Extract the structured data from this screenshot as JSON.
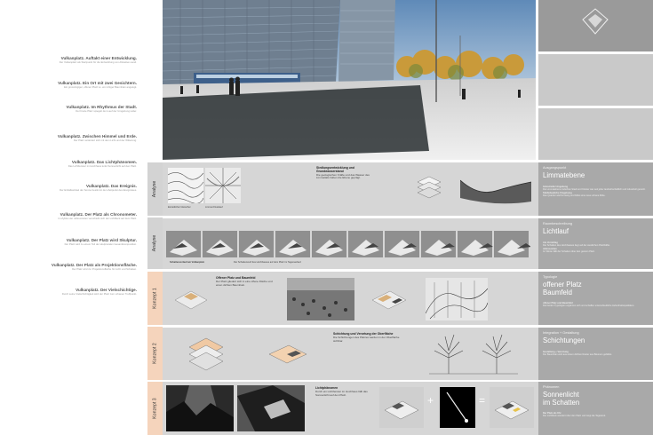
{
  "left_entries": [
    {
      "title": "Vulkanplatz. Auftakt einer Entwicklung.",
      "sub": "Der Vulkanplatz als Startpunkt für die Entwicklung von Altstetten-Land."
    },
    {
      "title": "Vulkanplatz. Ein Ort mit zwei Gesichtern.",
      "sub": "Ein grosszügiger, offener Platz vs. ein ruhiger Baumhain angelegt."
    },
    {
      "title": "Vulkanplatz. Im Rhythmus der Stadt.",
      "sub": "Der breite Platz spiegelt den Lauf der Umgebung wider."
    },
    {
      "title": "Vulkanplatz. Zwischen Himmel und Erde.",
      "sub": "Der Platz verändert sich mit dem Licht und der Witterung."
    },
    {
      "title": "Vulkanplatz. Das Lichtphänomen.",
      "sub": "Das Lichtfenster im Hochhaus lenkt Sonnenlicht auf den Platz."
    },
    {
      "title": "Vulkanplatz. Das Ereignis.",
      "sub": "Der Einfallswinkel der Sonne bestimmt den Zeitpunkt des Ereignisses."
    },
    {
      "title": "Vulkanplatz. Der Platz als Chronometer.",
      "sub": "Im Zyklus der Jahreszeiten verschiebt sich der Lichtfleck auf dem Platz."
    },
    {
      "title": "Vulkanplatz. Der Platz wird Skulptur.",
      "sub": "Der Platz wird zu einem Teil der skulpturalen Gesamtkomposition."
    },
    {
      "title": "Vulkanplatz. Der Platz als Projektionsfläche.",
      "sub": "Der Platz wird zur Projektionsfläche für Licht und Schatten."
    },
    {
      "title": "Vulkanplatz. Der Vielschichtige.",
      "sub": "Durch seine Vielschichtigkeit wird der Platz zum urbanen Treffpunkt."
    }
  ],
  "tabs": {
    "analyse_1": "Analyse",
    "analyse_2": "Analyse",
    "konzept_1": "Konzept 1",
    "konzept_2": "Konzept 2",
    "konzept_3": "Konzept 3"
  },
  "bands": {
    "b1": {
      "kicker": "Ausgangspunkt",
      "title": "Limmatebene",
      "heading": "Siedlungsentwicklung und Grundwasserstand",
      "text": "Die geologischen Kräfte und das Wasser des Limmattals haben die Ebene geprägt.",
      "caption_a": "Eiszeitlicher Gletscher",
      "caption_b": "Limmat Flusslauf",
      "p1_head": "Industrielle Umgebung",
      "p1": "Die Limmatebene zwischen Stadt und Kloster war seit jeher landwirtschaftlich und industriell genutzt.",
      "p2_head": "Städtebauliche Umgebung",
      "p2": "Das Quartier wächst stetig und bildet eine neue urbane Mitte."
    },
    "b2": {
      "kicker": "Raumbeschreibung",
      "title": "Lichtlauf",
      "caption": "Schattenverlauf am Vulkanplatz",
      "note": "Der Schattenwurf des Hochhauses auf dem Platz im Tagesverlauf.",
      "p1_head": "Am Vormittag",
      "p1": "Der Schatten des Hochhauses liegt auf der westlichen Platzhälfte.",
      "p2_head": "Jahreszeiten",
      "p2": "Im Winter fällt der Schatten über den ganzen Platz."
    },
    "b3": {
      "kicker": "Typologie",
      "title": "offener Platz\nBaumfeld",
      "heading": "Offener Platz und Baumfeld",
      "text": "Der Platz gliedert sich in eine offene Fläche und einen dichten Baumhain.",
      "p1_head": "offener Platz und Baumfeld",
      "p1": "Die beiden Typologien ergänzen sich und schaffen unterschiedliche Aufenthaltsqualitäten."
    },
    "b4": {
      "kicker": "Integration + Gestaltung",
      "title": "Schichtungen",
      "heading": "Schichtung und Verortung der Oberfläche",
      "text": "Die Schichtungen des Platzes werden in der Oberfläche sichtbar.",
      "p1_head": "Gestaltung + Verortung",
      "p1": "Der Baumhain wird aus einem dichten Raster aus Bäumen gebildet."
    },
    "b5": {
      "kicker": "Phänomen",
      "title": "Sonnenlicht\nim Schatten",
      "heading": "Lichtphänomen",
      "text": "Durch ein Lichtfenster im Hochhaus fällt das Sonnenlicht auf den Platz.",
      "p1_head": "Der Platz als Uhr",
      "p1": "Der Lichtfleck wandert über den Platz und zeigt die Tageszeit."
    },
    "plus": "+",
    "equals": "="
  },
  "colors": {
    "band_bg": "#d6d6d6",
    "panel_bg": "#a9a9a9",
    "tab_peach": "#f5d4bc",
    "tab_grey": "#d3d3d3"
  }
}
